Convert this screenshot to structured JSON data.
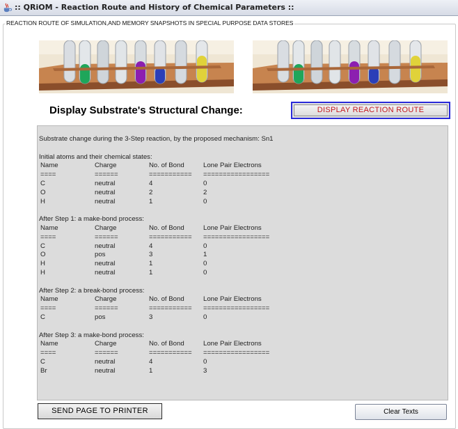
{
  "window": {
    "title": ":: QRiOM - Reaction Route and History of Chemical Parameters ::"
  },
  "panel": {
    "legend": "REACTION ROUTE OF SIMULATION,AND MEMORY SNAPSHOTS IN SPECIAL PURPOSE DATA STORES"
  },
  "heading": "Display Substrate's Structural Change:",
  "buttons": {
    "display_route": "DISPLAY REACTION ROUTE",
    "send_to_printer": "SEND PAGE TO PRINTER",
    "clear_texts": "Clear Texts"
  },
  "output": {
    "intro": "Substrate change during the 3-Step reaction, by the proposed mechanism: Sn1",
    "headers": [
      "Name",
      "Charge",
      "No. of Bond",
      "Lone Pair Electrons"
    ],
    "separators": [
      "====",
      "======",
      "===========",
      "================="
    ],
    "sections": [
      {
        "title": "Initial atoms and their chemical states:",
        "rows": [
          [
            "C",
            "neutral",
            "4",
            "0"
          ],
          [
            "O",
            "neutral",
            "2",
            "2"
          ],
          [
            "H",
            "neutral",
            "1",
            "0"
          ]
        ]
      },
      {
        "title": "After Step 1: a make-bond process:",
        "rows": [
          [
            "C",
            "neutral",
            "4",
            "0"
          ],
          [
            "O",
            "pos",
            "3",
            "1"
          ],
          [
            "H",
            "neutral",
            "1",
            "0"
          ],
          [
            "H",
            "neutral",
            "1",
            "0"
          ]
        ]
      },
      {
        "title": "After Step 2: a break-bond process:",
        "rows": [
          [
            "C",
            "pos",
            "3",
            "0"
          ]
        ]
      },
      {
        "title": "After Step 3: a make-bond process:",
        "rows": [
          [
            "C",
            "neutral",
            "4",
            "0"
          ],
          [
            "Br",
            "neutral",
            "1",
            "3"
          ]
        ]
      }
    ]
  },
  "colors": {
    "route_button_text": "#c2181d",
    "route_button_border": "#2a2ad8",
    "text_area_bg": "#dcdcdc"
  },
  "icons": {
    "app": "java-coffee-icon"
  }
}
